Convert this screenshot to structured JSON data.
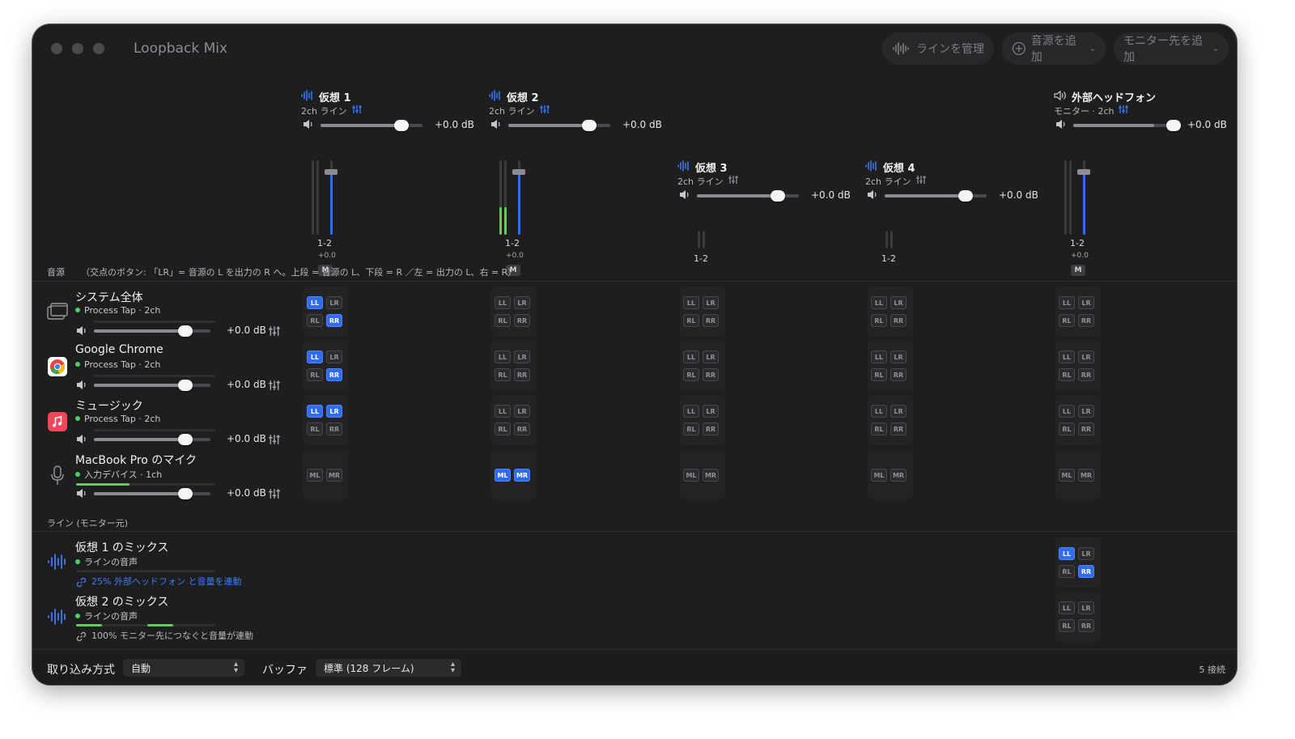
{
  "window": {
    "title": "Loopback Mix"
  },
  "toolbar": {
    "manage_lines": "ラインを管理",
    "add_source": "音源を追加",
    "add_monitor": "モニター先を追加"
  },
  "channels": [
    {
      "name": "仮想 1",
      "sub": "2ch ライン",
      "db": "+0.0 dB",
      "label": "1-2",
      "gain": "+0.0",
      "mute": "M"
    },
    {
      "name": "仮想 2",
      "sub": "2ch ライン",
      "db": "+0.0 dB",
      "label": "1-2",
      "gain": "+0.0",
      "mute": "M"
    },
    {
      "name": "仮想 3",
      "sub": "2ch ライン",
      "db": "+0.0 dB",
      "label": "1-2"
    },
    {
      "name": "仮想 4",
      "sub": "2ch ライン",
      "db": "+0.0 dB",
      "label": "1-2"
    },
    {
      "name": "外部ヘッドフォン",
      "sub": "モニター · 2ch",
      "db": "+0.0 dB",
      "label": "1-2",
      "gain": "+0.0",
      "mute": "M"
    }
  ],
  "sources_section": {
    "label": "音源",
    "hint": "（交点のボタン: 「LR」= 音源の L を出力の R へ。上段 = 音源の L、下段 = R ／左 = 出力の L、右 = R）"
  },
  "sources": [
    {
      "name": "システム全体",
      "sub": "Process Tap · 2ch",
      "db": "+0.0 dB",
      "icon": "system-audio-icon"
    },
    {
      "name": "Google Chrome",
      "sub": "Process Tap · 2ch",
      "db": "+0.0 dB",
      "icon": "chrome-icon"
    },
    {
      "name": "ミュージック",
      "sub": "Process Tap · 2ch",
      "db": "+0.0 dB",
      "icon": "music-icon"
    },
    {
      "name": "MacBook Pro のマイク",
      "sub": "入力デバイス · 1ch",
      "db": "+0.0 dB",
      "icon": "microphone-icon"
    }
  ],
  "matrix_labels": {
    "ll": "LL",
    "lr": "LR",
    "rl": "RL",
    "rr": "RR",
    "ml": "ML",
    "mr": "MR"
  },
  "matrix_active": {
    "system": [
      [
        "LL",
        "RR"
      ],
      [],
      [],
      [],
      []
    ],
    "chrome": [
      [
        "LL",
        "RR"
      ],
      [],
      [],
      [],
      []
    ],
    "music": [
      [
        "LL",
        "LR"
      ],
      [],
      [],
      [],
      []
    ],
    "mic": [
      [],
      [
        "ML",
        "MR"
      ],
      [],
      [],
      []
    ],
    "mix1": [
      "LL",
      "RR"
    ],
    "mix2": []
  },
  "lines_section": {
    "label": "ライン (モニター元)"
  },
  "lines": [
    {
      "name": "仮想 1 のミックス",
      "sub": "ラインの音声",
      "link": "25% 外部ヘッドフォン と音量を連動"
    },
    {
      "name": "仮想 2 のミックス",
      "sub": "ラインの音声",
      "link": "100% モニター先につなぐと音量が連動"
    }
  ],
  "bottom": {
    "capture_label": "取り込み方式",
    "capture_value": "自動",
    "buffer_label": "バッファ",
    "buffer_value": "標準 (128 フレーム)",
    "connections": "5 接続"
  },
  "colors": {
    "accent": "#2f6cf0",
    "level_green": "#5ecf5a",
    "window_bg": "#1e1e20"
  }
}
